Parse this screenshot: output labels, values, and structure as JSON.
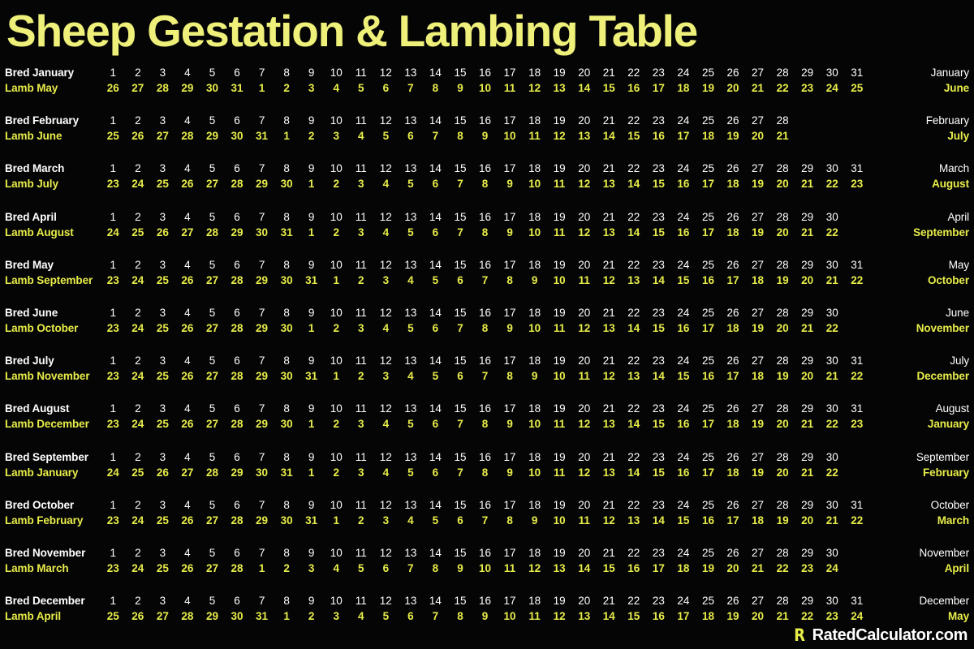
{
  "title": "Sheep Gestation & Lambing Table",
  "colors": {
    "background": "#050505",
    "title": "#eef07a",
    "bred_text": "#ffffff",
    "lamb_text": "#e8ed4a"
  },
  "footer": {
    "logo_mark": "R",
    "logo_text": "RatedCalculator.com"
  },
  "table": {
    "rows": [
      {
        "bred_label": "Bred January",
        "lamb_label": "Lamb May",
        "bred_month_right": "January",
        "lamb_month_right": "June",
        "bred_days": [
          1,
          2,
          3,
          4,
          5,
          6,
          7,
          8,
          9,
          10,
          11,
          12,
          13,
          14,
          15,
          16,
          17,
          18,
          19,
          20,
          21,
          22,
          23,
          24,
          25,
          26,
          27,
          28,
          29,
          30,
          31
        ],
        "lamb_days": [
          26,
          27,
          28,
          29,
          30,
          31,
          1,
          2,
          3,
          4,
          5,
          6,
          7,
          8,
          9,
          10,
          11,
          12,
          13,
          14,
          15,
          16,
          17,
          18,
          19,
          20,
          21,
          22,
          23,
          24,
          25
        ]
      },
      {
        "bred_label": "Bred February",
        "lamb_label": "Lamb June",
        "bred_month_right": "February",
        "lamb_month_right": "July",
        "bred_days": [
          1,
          2,
          3,
          4,
          5,
          6,
          7,
          8,
          9,
          10,
          11,
          12,
          13,
          14,
          15,
          16,
          17,
          18,
          19,
          20,
          21,
          22,
          23,
          24,
          25,
          26,
          27,
          28
        ],
        "lamb_days": [
          25,
          26,
          27,
          28,
          29,
          30,
          31,
          1,
          2,
          3,
          4,
          5,
          6,
          7,
          8,
          9,
          10,
          11,
          12,
          13,
          14,
          15,
          16,
          17,
          18,
          19,
          20,
          21
        ]
      },
      {
        "bred_label": "Bred March",
        "lamb_label": "Lamb July",
        "bred_month_right": "March",
        "lamb_month_right": "August",
        "bred_days": [
          1,
          2,
          3,
          4,
          5,
          6,
          7,
          8,
          9,
          10,
          11,
          12,
          13,
          14,
          15,
          16,
          17,
          18,
          19,
          20,
          21,
          22,
          23,
          24,
          25,
          26,
          27,
          28,
          29,
          30,
          31
        ],
        "lamb_days": [
          23,
          24,
          25,
          26,
          27,
          28,
          29,
          30,
          1,
          2,
          3,
          4,
          5,
          6,
          7,
          8,
          9,
          10,
          11,
          12,
          13,
          14,
          15,
          16,
          17,
          18,
          19,
          20,
          21,
          22,
          23
        ]
      },
      {
        "bred_label": "Bred April",
        "lamb_label": "Lamb August",
        "bred_month_right": "April",
        "lamb_month_right": "September",
        "bred_days": [
          1,
          2,
          3,
          4,
          5,
          6,
          7,
          8,
          9,
          10,
          11,
          12,
          13,
          14,
          15,
          16,
          17,
          18,
          19,
          20,
          21,
          22,
          23,
          24,
          25,
          26,
          27,
          28,
          29,
          30
        ],
        "lamb_days": [
          24,
          25,
          26,
          27,
          28,
          29,
          30,
          31,
          1,
          2,
          3,
          4,
          5,
          6,
          7,
          8,
          9,
          10,
          11,
          12,
          13,
          14,
          15,
          16,
          17,
          18,
          19,
          20,
          21,
          22
        ]
      },
      {
        "bred_label": "Bred May",
        "lamb_label": "Lamb September",
        "bred_month_right": "May",
        "lamb_month_right": "October",
        "bred_days": [
          1,
          2,
          3,
          4,
          5,
          6,
          7,
          8,
          9,
          10,
          11,
          12,
          13,
          14,
          15,
          16,
          17,
          18,
          19,
          20,
          21,
          22,
          23,
          24,
          25,
          26,
          27,
          28,
          29,
          30,
          31
        ],
        "lamb_days": [
          23,
          24,
          25,
          26,
          27,
          28,
          29,
          30,
          31,
          1,
          2,
          3,
          4,
          5,
          6,
          7,
          8,
          9,
          10,
          11,
          12,
          13,
          14,
          15,
          16,
          17,
          18,
          19,
          20,
          21,
          22
        ]
      },
      {
        "bred_label": "Bred June",
        "lamb_label": "Lamb October",
        "bred_month_right": "June",
        "lamb_month_right": "November",
        "bred_days": [
          1,
          2,
          3,
          4,
          5,
          6,
          7,
          8,
          9,
          10,
          11,
          12,
          13,
          14,
          15,
          16,
          17,
          18,
          19,
          20,
          21,
          22,
          23,
          24,
          25,
          26,
          27,
          28,
          29,
          30
        ],
        "lamb_days": [
          23,
          24,
          25,
          26,
          27,
          28,
          29,
          30,
          1,
          2,
          3,
          4,
          5,
          6,
          7,
          8,
          9,
          10,
          11,
          12,
          13,
          14,
          15,
          16,
          17,
          18,
          19,
          20,
          21,
          22
        ]
      },
      {
        "bred_label": "Bred July",
        "lamb_label": "Lamb November",
        "bred_month_right": "July",
        "lamb_month_right": "December",
        "bred_days": [
          1,
          2,
          3,
          4,
          5,
          6,
          7,
          8,
          9,
          10,
          11,
          12,
          13,
          14,
          15,
          16,
          17,
          18,
          19,
          20,
          21,
          22,
          23,
          24,
          25,
          26,
          27,
          28,
          29,
          30,
          31
        ],
        "lamb_days": [
          23,
          24,
          25,
          26,
          27,
          28,
          29,
          30,
          31,
          1,
          2,
          3,
          4,
          5,
          6,
          7,
          8,
          9,
          10,
          11,
          12,
          13,
          14,
          15,
          16,
          17,
          18,
          19,
          20,
          21,
          22
        ]
      },
      {
        "bred_label": "Bred August",
        "lamb_label": "Lamb December",
        "bred_month_right": "August",
        "lamb_month_right": "January",
        "bred_days": [
          1,
          2,
          3,
          4,
          5,
          6,
          7,
          8,
          9,
          10,
          11,
          12,
          13,
          14,
          15,
          16,
          17,
          18,
          19,
          20,
          21,
          22,
          23,
          24,
          25,
          26,
          27,
          28,
          29,
          30,
          31
        ],
        "lamb_days": [
          23,
          24,
          25,
          26,
          27,
          28,
          29,
          30,
          1,
          2,
          3,
          4,
          5,
          6,
          7,
          8,
          9,
          10,
          11,
          12,
          13,
          14,
          15,
          16,
          17,
          18,
          19,
          20,
          21,
          22,
          23
        ]
      },
      {
        "bred_label": "Bred September",
        "lamb_label": "Lamb January",
        "bred_month_right": "September",
        "lamb_month_right": "February",
        "bred_days": [
          1,
          2,
          3,
          4,
          5,
          6,
          7,
          8,
          9,
          10,
          11,
          12,
          13,
          14,
          15,
          16,
          17,
          18,
          19,
          20,
          21,
          22,
          23,
          24,
          25,
          26,
          27,
          28,
          29,
          30
        ],
        "lamb_days": [
          24,
          25,
          26,
          27,
          28,
          29,
          30,
          31,
          1,
          2,
          3,
          4,
          5,
          6,
          7,
          8,
          9,
          10,
          11,
          12,
          13,
          14,
          15,
          16,
          17,
          18,
          19,
          20,
          21,
          22
        ]
      },
      {
        "bred_label": "Bred October",
        "lamb_label": "Lamb February",
        "bred_month_right": "October",
        "lamb_month_right": "March",
        "bred_days": [
          1,
          2,
          3,
          4,
          5,
          6,
          7,
          8,
          9,
          10,
          11,
          12,
          13,
          14,
          15,
          16,
          17,
          18,
          19,
          20,
          21,
          22,
          23,
          24,
          25,
          26,
          27,
          28,
          29,
          30,
          31
        ],
        "lamb_days": [
          23,
          24,
          25,
          26,
          27,
          28,
          29,
          30,
          31,
          1,
          2,
          3,
          4,
          5,
          6,
          7,
          8,
          9,
          10,
          11,
          12,
          13,
          14,
          15,
          16,
          17,
          18,
          19,
          20,
          21,
          22
        ]
      },
      {
        "bred_label": "Bred November",
        "lamb_label": "Lamb March",
        "bred_month_right": "November",
        "lamb_month_right": "April",
        "bred_days": [
          1,
          2,
          3,
          4,
          5,
          6,
          7,
          8,
          9,
          10,
          11,
          12,
          13,
          14,
          15,
          16,
          17,
          18,
          19,
          20,
          21,
          22,
          23,
          24,
          25,
          26,
          27,
          28,
          29,
          30
        ],
        "lamb_days": [
          23,
          24,
          25,
          26,
          27,
          28,
          1,
          2,
          3,
          4,
          5,
          6,
          7,
          8,
          9,
          10,
          11,
          12,
          13,
          14,
          15,
          16,
          17,
          18,
          19,
          20,
          21,
          22,
          23,
          24
        ]
      },
      {
        "bred_label": "Bred December",
        "lamb_label": "Lamb April",
        "bred_month_right": "December",
        "lamb_month_right": "May",
        "bred_days": [
          1,
          2,
          3,
          4,
          5,
          6,
          7,
          8,
          9,
          10,
          11,
          12,
          13,
          14,
          15,
          16,
          17,
          18,
          19,
          20,
          21,
          22,
          23,
          24,
          25,
          26,
          27,
          28,
          29,
          30,
          31
        ],
        "lamb_days": [
          25,
          26,
          27,
          28,
          29,
          30,
          31,
          1,
          2,
          3,
          4,
          5,
          6,
          7,
          8,
          9,
          10,
          11,
          12,
          13,
          14,
          15,
          16,
          17,
          18,
          19,
          20,
          21,
          22,
          23,
          24
        ]
      }
    ]
  }
}
